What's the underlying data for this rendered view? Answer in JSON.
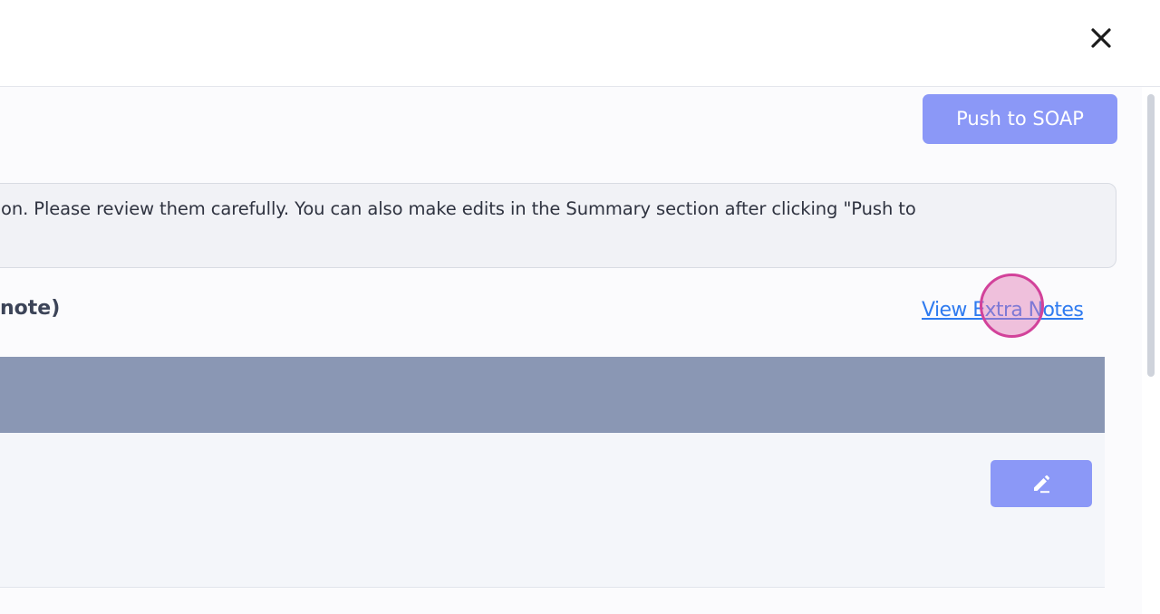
{
  "header": {
    "close_icon": "close-icon"
  },
  "toolbar": {
    "push_label": "Push to SOAP"
  },
  "info": {
    "text": "on. Please review them carefully. You can also make edits in the Summary section after clicking \"Push to"
  },
  "section": {
    "title": "note)",
    "link_label": "View Extra Notes"
  },
  "table": {
    "edit_icon": "pencil-icon"
  },
  "colors": {
    "accent": "#8b98f7",
    "link": "#2f7bf0",
    "table_header": "#8a97b4",
    "click_marker": "#d2429a"
  }
}
